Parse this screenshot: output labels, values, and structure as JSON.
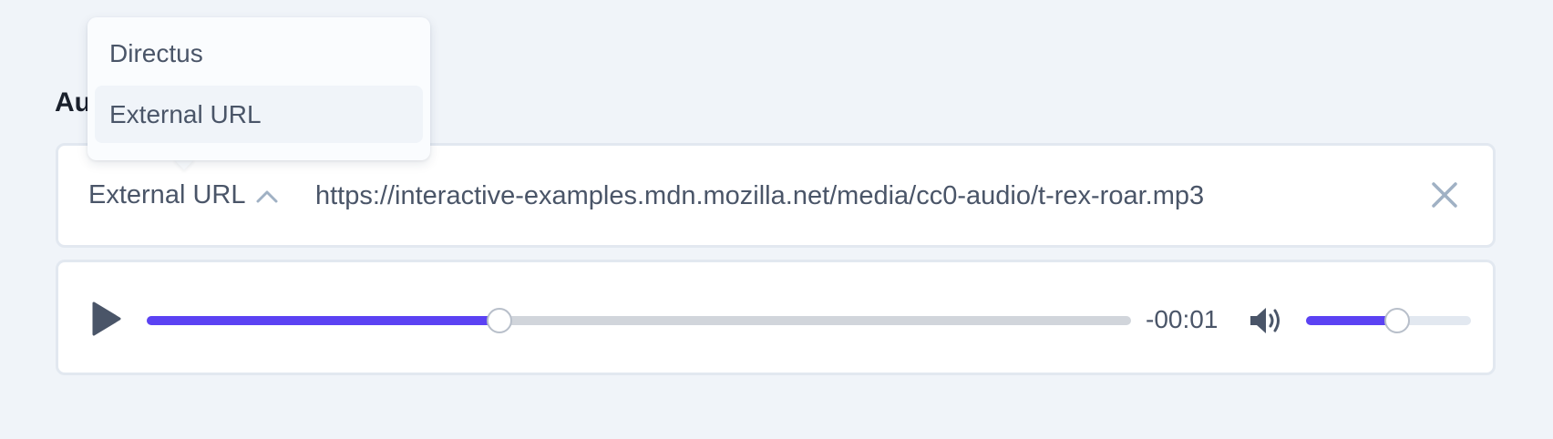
{
  "field": {
    "label": "Audio"
  },
  "source": {
    "selected": "External URL",
    "url_value": "https://interactive-examples.mdn.mozilla.net/media/cc0-audio/t-rex-roar.mp3"
  },
  "dropdown": {
    "options": [
      {
        "label": "Directus",
        "active": false
      },
      {
        "label": "External URL",
        "active": true
      }
    ]
  },
  "player": {
    "progress": 0.358,
    "time_remaining": "-00:01",
    "volume": 0.55
  },
  "colors": {
    "accent": "#5b42f3",
    "page_background": "#f0f4f9",
    "text": "#4a5568",
    "icon_muted": "#a0b1c4"
  },
  "icons": {
    "source_toggle": "chevron-up-icon",
    "clear": "close-icon",
    "play": "play-icon",
    "volume": "volume-icon"
  }
}
